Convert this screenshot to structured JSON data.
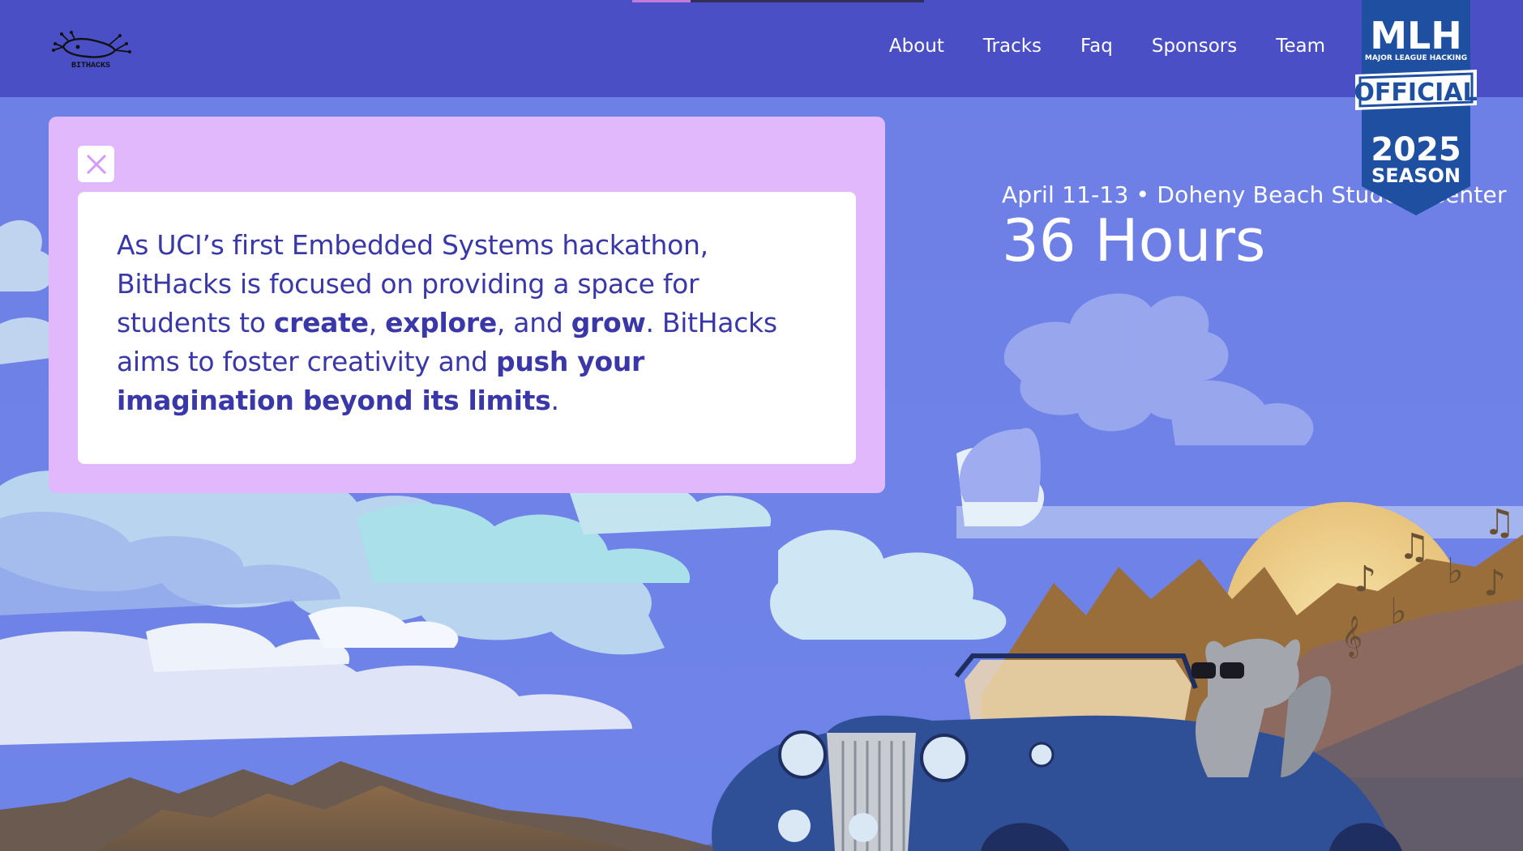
{
  "brand": {
    "logo_text": "BITHACKS"
  },
  "nav": {
    "items": [
      {
        "label": "About"
      },
      {
        "label": "Tracks"
      },
      {
        "label": "Faq"
      },
      {
        "label": "Sponsors"
      },
      {
        "label": "Team"
      }
    ]
  },
  "mlh_badge": {
    "title": "MLH",
    "subtitle": "MAJOR LEAGUE HACKING",
    "ribbon": "OFFICIAL",
    "year": "2025",
    "season": "SEASON"
  },
  "hero": {
    "date_location": "April 11-13 • Doheny Beach Student Center",
    "duration": "36 Hours"
  },
  "modal": {
    "close_icon": "close-icon",
    "text": {
      "p1": "As UCI’s first Embedded Systems hackathon, BitHacks is focused on providing a space for students to ",
      "create": "create",
      "sep1": ", ",
      "explore": "explore",
      "sep2": ", and ",
      "grow": "grow",
      "p2": ". BitHacks aims to foster creativity and ",
      "push": "push your imagination beyond its limits",
      "end": "."
    }
  },
  "colors": {
    "navbar": "#4a4fc6",
    "sky": "#6b80e6",
    "modal_bg": "#e0b8fb",
    "text": "#3a37a8",
    "car": "#2f4f96",
    "mlh_blue": "#1f4fa0"
  }
}
